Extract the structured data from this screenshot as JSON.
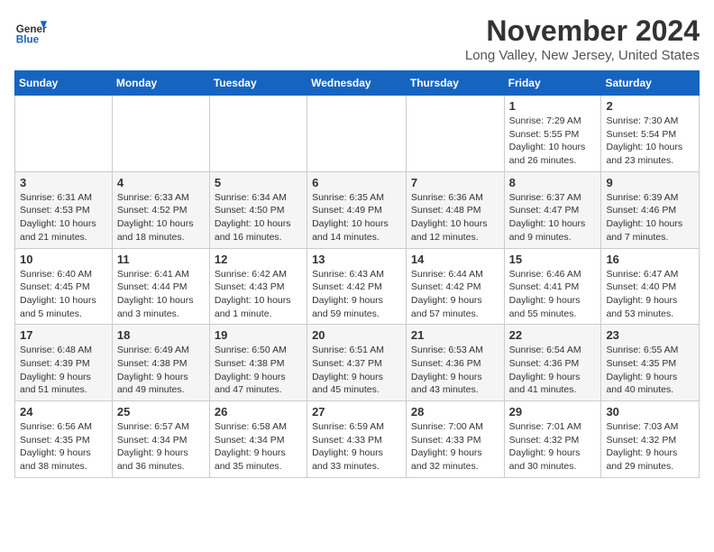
{
  "header": {
    "logo_general": "General",
    "logo_blue": "Blue",
    "month_title": "November 2024",
    "location": "Long Valley, New Jersey, United States"
  },
  "days_of_week": [
    "Sunday",
    "Monday",
    "Tuesday",
    "Wednesday",
    "Thursday",
    "Friday",
    "Saturday"
  ],
  "weeks": [
    [
      {
        "day": "",
        "info": ""
      },
      {
        "day": "",
        "info": ""
      },
      {
        "day": "",
        "info": ""
      },
      {
        "day": "",
        "info": ""
      },
      {
        "day": "",
        "info": ""
      },
      {
        "day": "1",
        "info": "Sunrise: 7:29 AM\nSunset: 5:55 PM\nDaylight: 10 hours and 26 minutes."
      },
      {
        "day": "2",
        "info": "Sunrise: 7:30 AM\nSunset: 5:54 PM\nDaylight: 10 hours and 23 minutes."
      }
    ],
    [
      {
        "day": "3",
        "info": "Sunrise: 6:31 AM\nSunset: 4:53 PM\nDaylight: 10 hours and 21 minutes."
      },
      {
        "day": "4",
        "info": "Sunrise: 6:33 AM\nSunset: 4:52 PM\nDaylight: 10 hours and 18 minutes."
      },
      {
        "day": "5",
        "info": "Sunrise: 6:34 AM\nSunset: 4:50 PM\nDaylight: 10 hours and 16 minutes."
      },
      {
        "day": "6",
        "info": "Sunrise: 6:35 AM\nSunset: 4:49 PM\nDaylight: 10 hours and 14 minutes."
      },
      {
        "day": "7",
        "info": "Sunrise: 6:36 AM\nSunset: 4:48 PM\nDaylight: 10 hours and 12 minutes."
      },
      {
        "day": "8",
        "info": "Sunrise: 6:37 AM\nSunset: 4:47 PM\nDaylight: 10 hours and 9 minutes."
      },
      {
        "day": "9",
        "info": "Sunrise: 6:39 AM\nSunset: 4:46 PM\nDaylight: 10 hours and 7 minutes."
      }
    ],
    [
      {
        "day": "10",
        "info": "Sunrise: 6:40 AM\nSunset: 4:45 PM\nDaylight: 10 hours and 5 minutes."
      },
      {
        "day": "11",
        "info": "Sunrise: 6:41 AM\nSunset: 4:44 PM\nDaylight: 10 hours and 3 minutes."
      },
      {
        "day": "12",
        "info": "Sunrise: 6:42 AM\nSunset: 4:43 PM\nDaylight: 10 hours and 1 minute."
      },
      {
        "day": "13",
        "info": "Sunrise: 6:43 AM\nSunset: 4:42 PM\nDaylight: 9 hours and 59 minutes."
      },
      {
        "day": "14",
        "info": "Sunrise: 6:44 AM\nSunset: 4:42 PM\nDaylight: 9 hours and 57 minutes."
      },
      {
        "day": "15",
        "info": "Sunrise: 6:46 AM\nSunset: 4:41 PM\nDaylight: 9 hours and 55 minutes."
      },
      {
        "day": "16",
        "info": "Sunrise: 6:47 AM\nSunset: 4:40 PM\nDaylight: 9 hours and 53 minutes."
      }
    ],
    [
      {
        "day": "17",
        "info": "Sunrise: 6:48 AM\nSunset: 4:39 PM\nDaylight: 9 hours and 51 minutes."
      },
      {
        "day": "18",
        "info": "Sunrise: 6:49 AM\nSunset: 4:38 PM\nDaylight: 9 hours and 49 minutes."
      },
      {
        "day": "19",
        "info": "Sunrise: 6:50 AM\nSunset: 4:38 PM\nDaylight: 9 hours and 47 minutes."
      },
      {
        "day": "20",
        "info": "Sunrise: 6:51 AM\nSunset: 4:37 PM\nDaylight: 9 hours and 45 minutes."
      },
      {
        "day": "21",
        "info": "Sunrise: 6:53 AM\nSunset: 4:36 PM\nDaylight: 9 hours and 43 minutes."
      },
      {
        "day": "22",
        "info": "Sunrise: 6:54 AM\nSunset: 4:36 PM\nDaylight: 9 hours and 41 minutes."
      },
      {
        "day": "23",
        "info": "Sunrise: 6:55 AM\nSunset: 4:35 PM\nDaylight: 9 hours and 40 minutes."
      }
    ],
    [
      {
        "day": "24",
        "info": "Sunrise: 6:56 AM\nSunset: 4:35 PM\nDaylight: 9 hours and 38 minutes."
      },
      {
        "day": "25",
        "info": "Sunrise: 6:57 AM\nSunset: 4:34 PM\nDaylight: 9 hours and 36 minutes."
      },
      {
        "day": "26",
        "info": "Sunrise: 6:58 AM\nSunset: 4:34 PM\nDaylight: 9 hours and 35 minutes."
      },
      {
        "day": "27",
        "info": "Sunrise: 6:59 AM\nSunset: 4:33 PM\nDaylight: 9 hours and 33 minutes."
      },
      {
        "day": "28",
        "info": "Sunrise: 7:00 AM\nSunset: 4:33 PM\nDaylight: 9 hours and 32 minutes."
      },
      {
        "day": "29",
        "info": "Sunrise: 7:01 AM\nSunset: 4:32 PM\nDaylight: 9 hours and 30 minutes."
      },
      {
        "day": "30",
        "info": "Sunrise: 7:03 AM\nSunset: 4:32 PM\nDaylight: 9 hours and 29 minutes."
      }
    ]
  ]
}
